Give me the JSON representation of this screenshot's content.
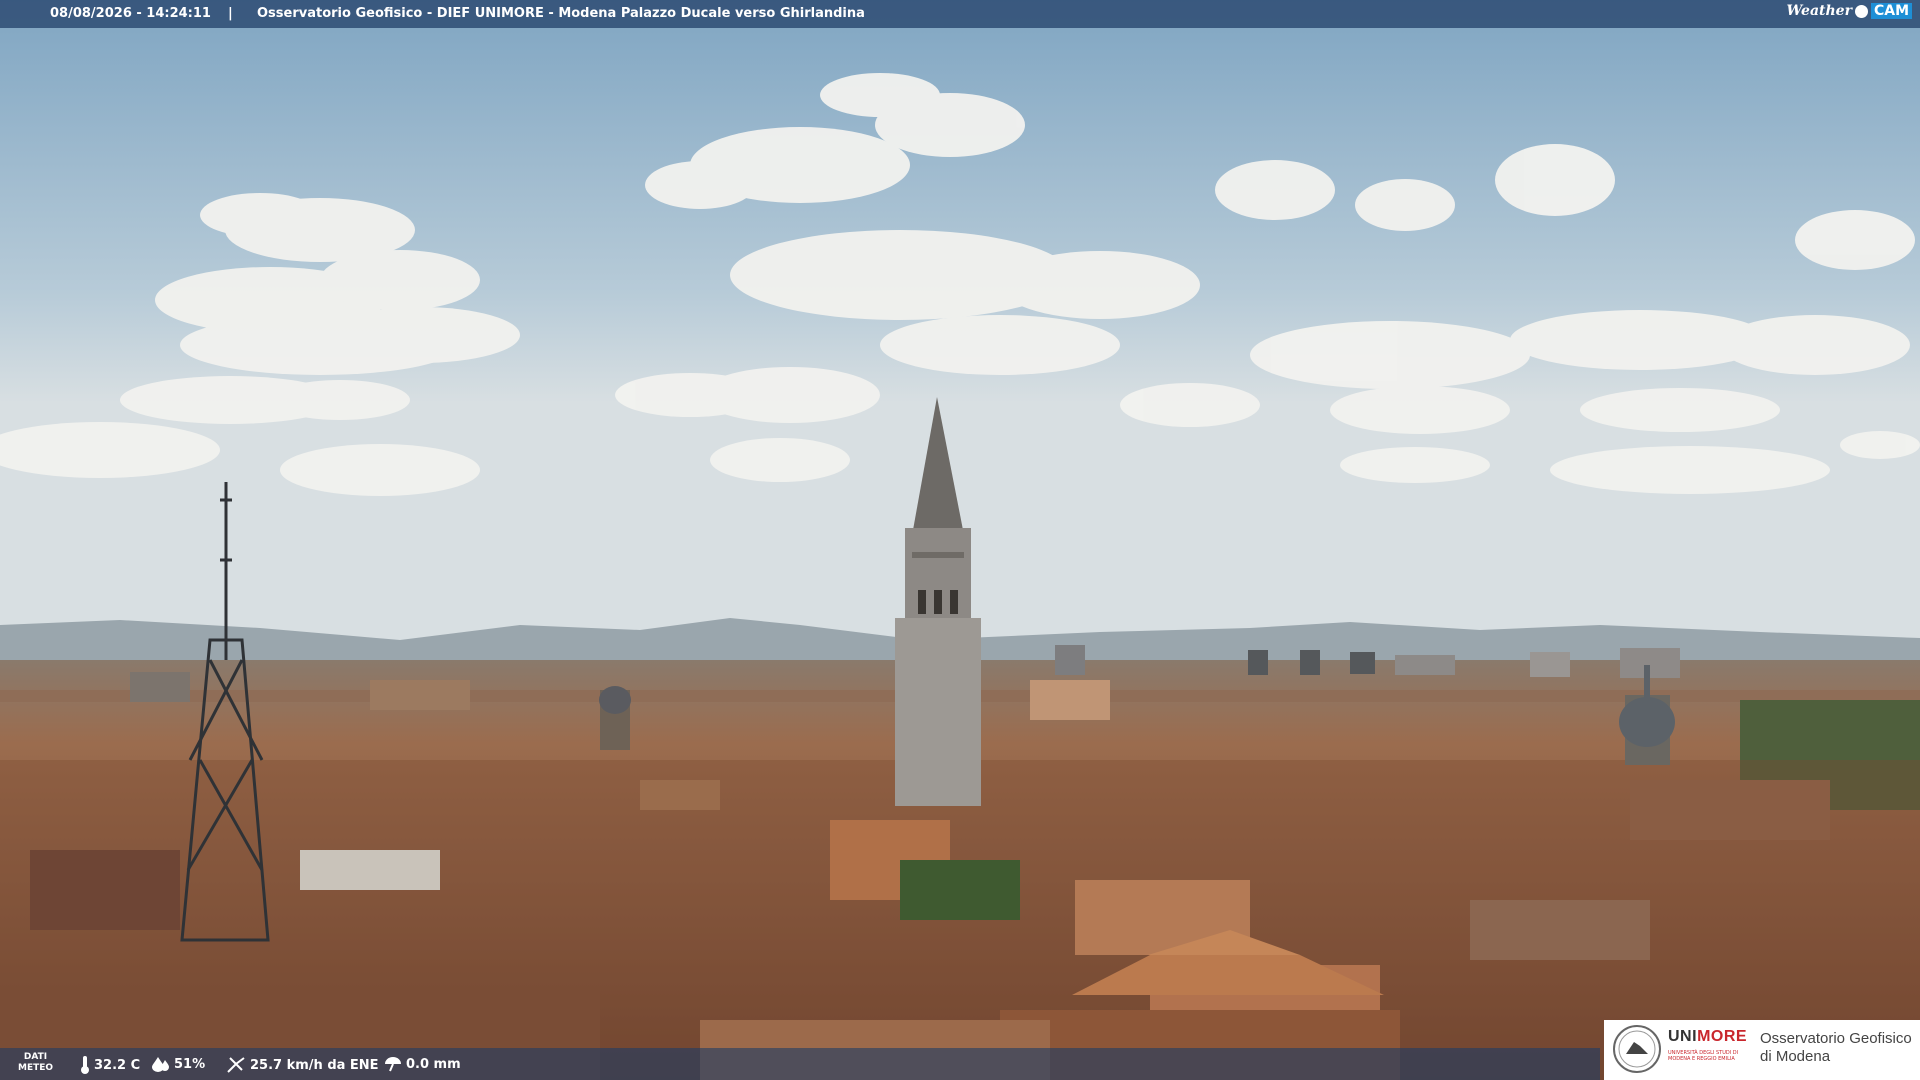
{
  "overlay": {
    "timestamp": "08/08/2026 - 14:24:11",
    "separator": "|",
    "title": "Osservatorio Geofisico - DIEF UNIMORE - Modena Palazzo Ducale verso Ghirlandina",
    "brand_left": "Weather",
    "brand_right": "CAM"
  },
  "weather": {
    "label_line1": "DATI",
    "label_line2": "METEO",
    "temperature": "32.2 C",
    "humidity": "51%",
    "wind": "25.7 km/h da ENE",
    "rain": "0.0 mm"
  },
  "logo": {
    "uni_part1": "UNI",
    "uni_part2": "MORE",
    "uni_sub": "UNIVERSITÀ DEGLI STUDI DI MODENA E REGGIO EMILIA",
    "obs_line1": "Osservatorio Geofisico",
    "obs_line2": "di Modena"
  },
  "colors": {
    "sky_top": "#8fb0c8",
    "sky_horizon": "#d8dfe2",
    "roof": "#a56a45",
    "overlay_bar": "#28466e",
    "brand_accent": "#1e8fd6",
    "unimore_red": "#c9262c"
  },
  "icons": [
    "thermometer-icon",
    "humidity-drop-icon",
    "wind-icon",
    "rain-gauge-icon",
    "weathercam-dot-icon",
    "unimore-seal-icon"
  ]
}
